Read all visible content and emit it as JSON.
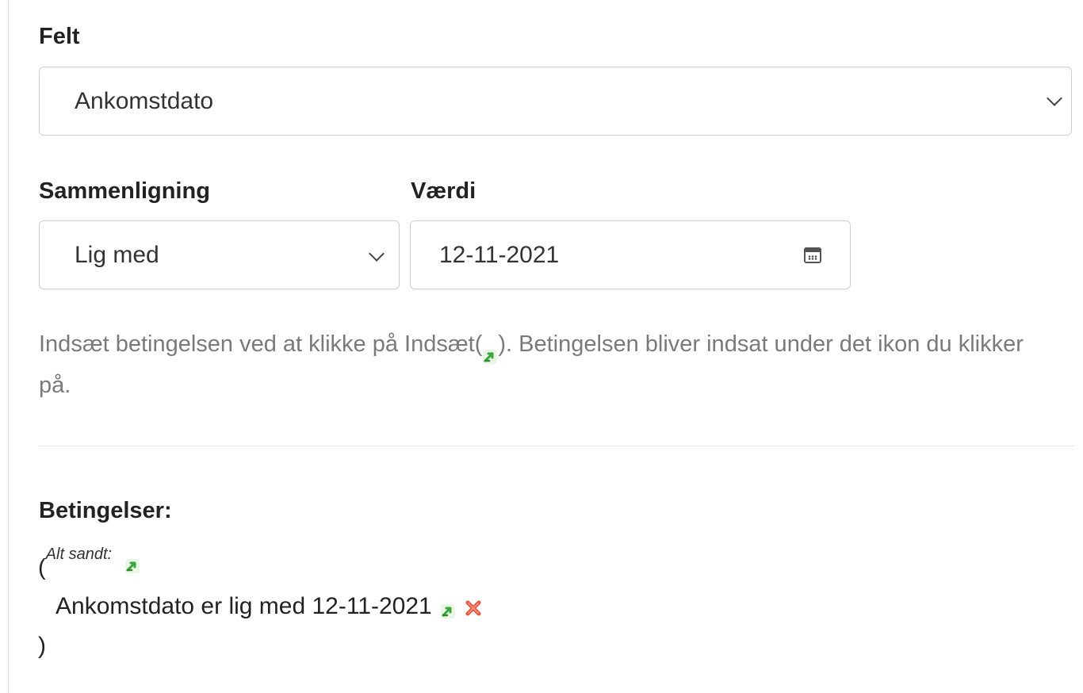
{
  "filter": {
    "field_label": "Felt",
    "field_value": "Ankomstdato",
    "comparison_label": "Sammenligning",
    "comparison_value": "Lig med",
    "value_label": "Værdi",
    "value_value": "12-11-2021"
  },
  "help": {
    "text_before": "Indsæt betingelsen ved at klikke på Indsæt(",
    "text_after": "). Betingelsen bliver indsat under det ikon du klikker på."
  },
  "conditions": {
    "heading": "Betingelser:",
    "open_paren": "(",
    "group_label": "Alt sandt:",
    "items": [
      {
        "text": "Ankomstdato er lig med 12-11-2021"
      }
    ],
    "close_paren": ")"
  },
  "colors": {
    "insert_icon": "#3aa53a",
    "remove_icon": "#e5533d",
    "help_text": "#7a7a7a"
  },
  "icons": {
    "select_chevron": "chevron-down-icon",
    "date_picker": "calendar-icon",
    "insert": "insert-arrow-icon",
    "remove": "remove-x-icon"
  }
}
